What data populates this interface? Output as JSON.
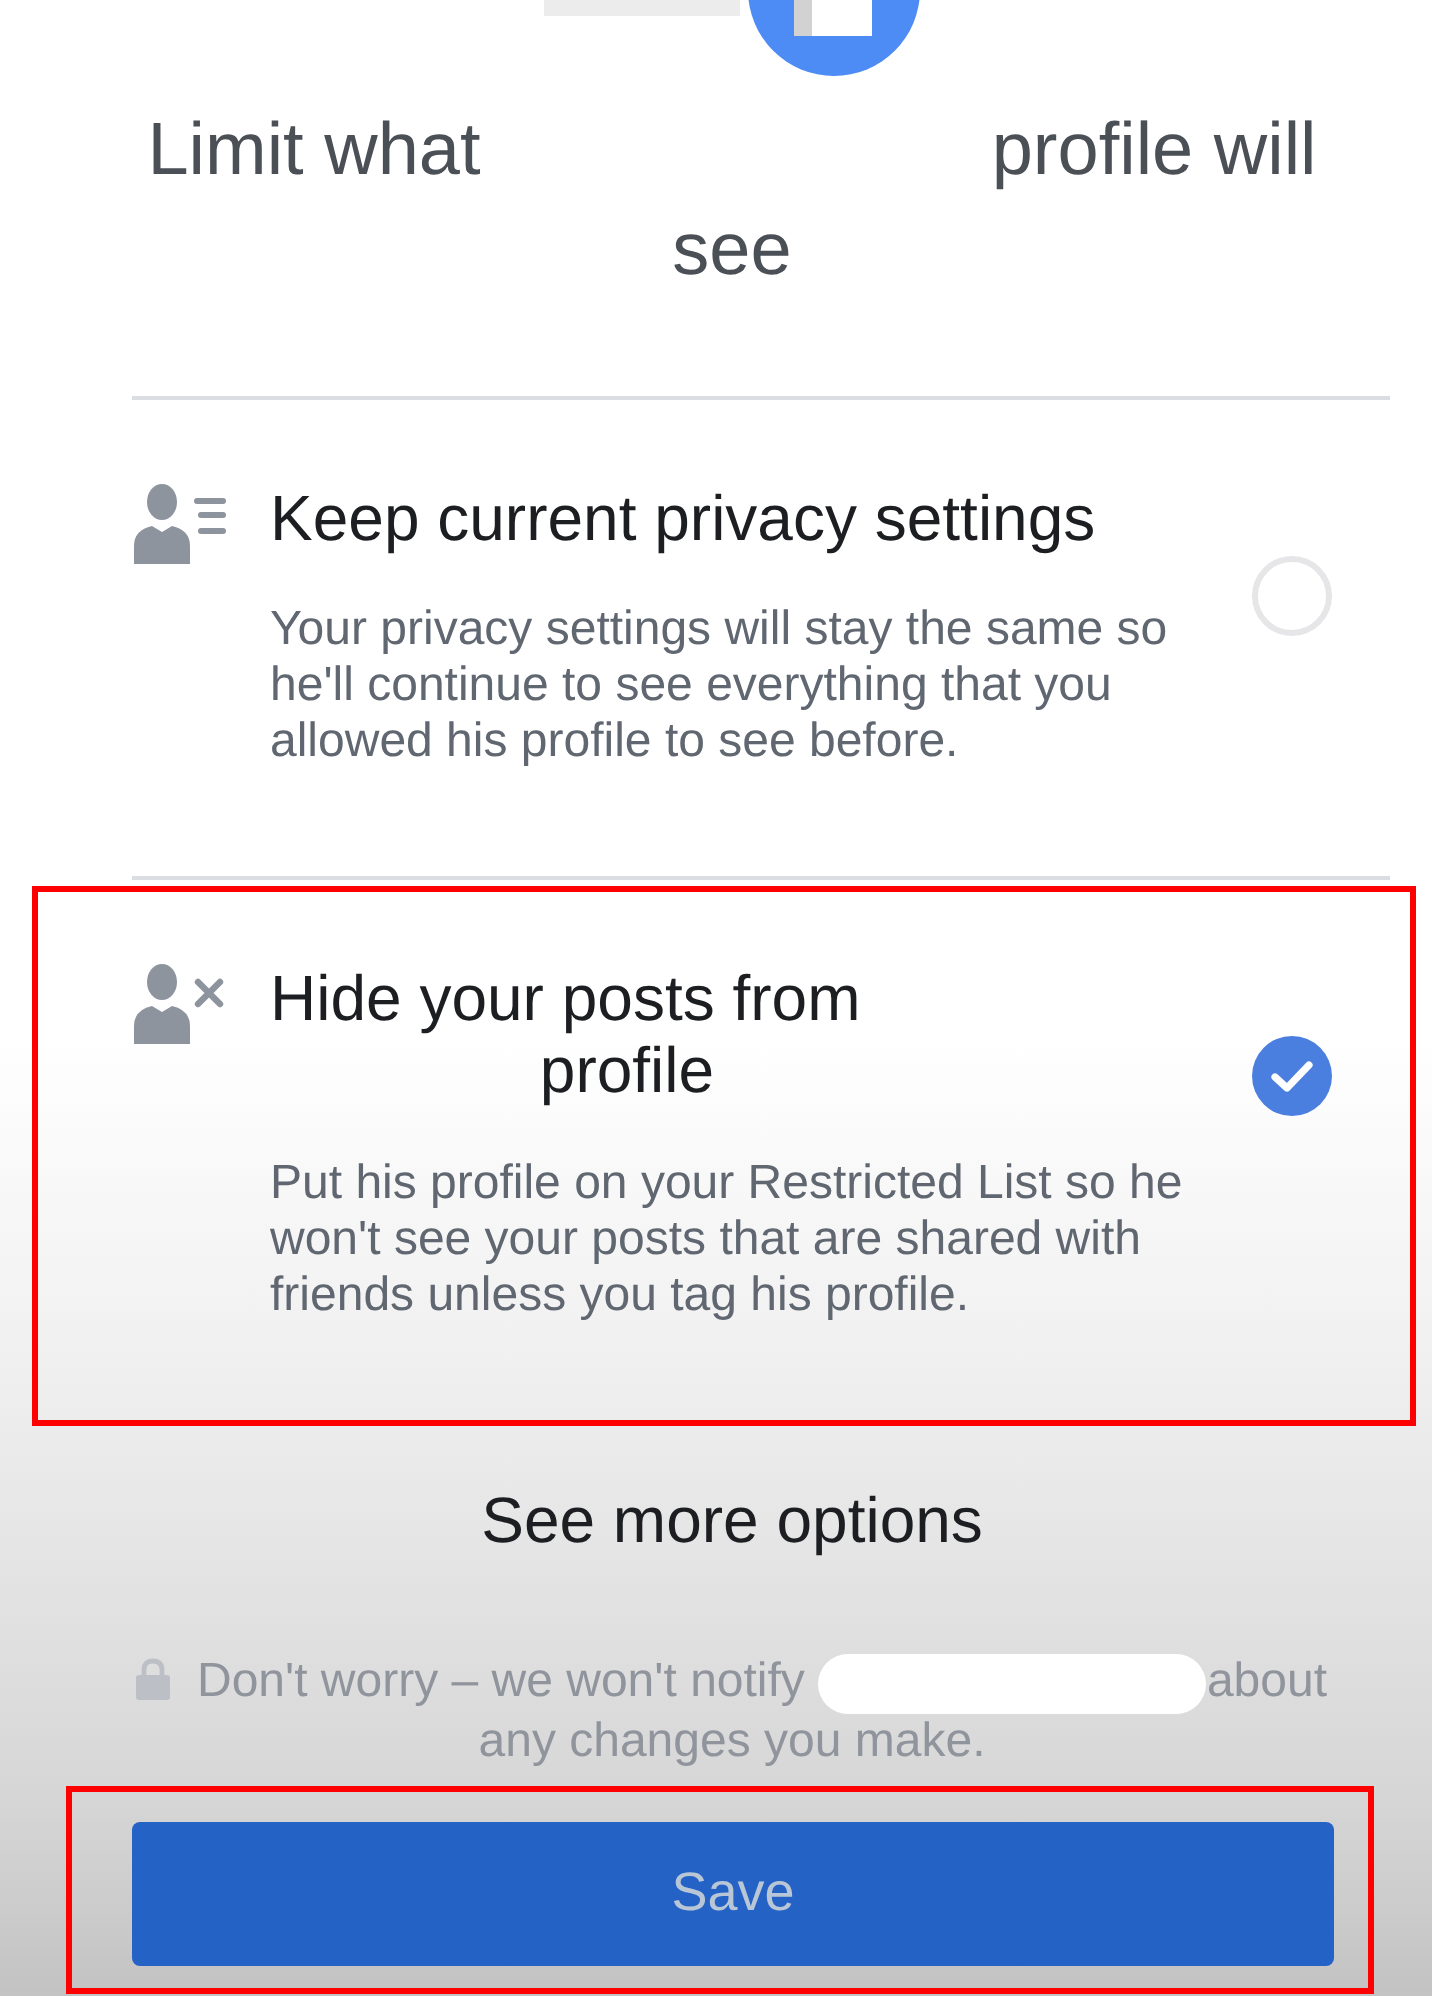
{
  "title": {
    "parts": [
      "Limit what",
      "profile will see"
    ]
  },
  "options": [
    {
      "kind": "keep",
      "title_parts": [
        "Keep current privacy settings"
      ],
      "description": "Your privacy settings will stay the same so he'll continue to see everything that you allowed his profile to see before.",
      "selected": false,
      "highlighted": false
    },
    {
      "kind": "restrict",
      "title_parts": [
        "Hide your posts from",
        "profile"
      ],
      "description": "Put his profile on your Restricted List so he won't see your posts that are shared with friends unless you tag his profile.",
      "selected": true,
      "highlighted": true
    }
  ],
  "more_options": {
    "label": "See more options"
  },
  "notice": {
    "parts": [
      "Don't worry – we won't notify",
      "about any changes you make."
    ]
  },
  "save_button": {
    "label": "Save",
    "highlighted": true
  }
}
